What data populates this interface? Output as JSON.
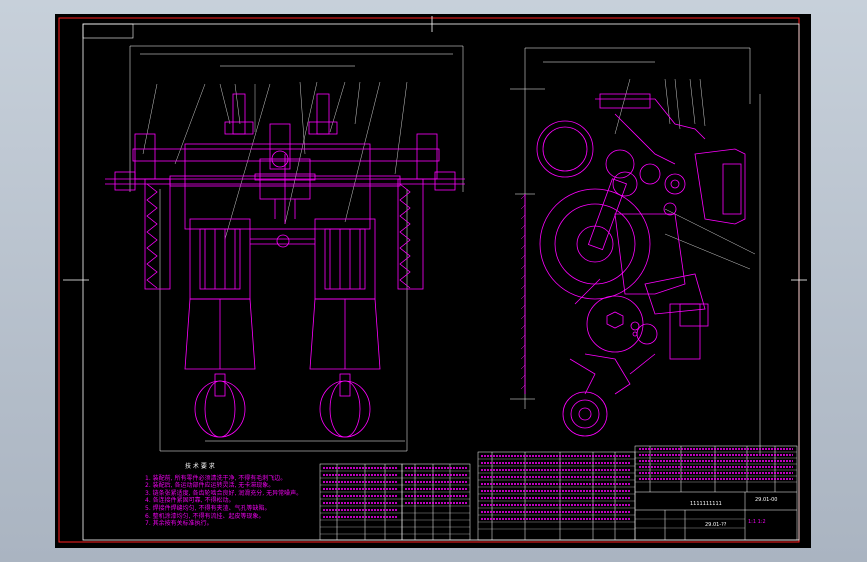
{
  "drawing": {
    "title_block_code": "29.01-00",
    "title_block_code_alt": "29.01-??",
    "title_block_text": "1111111111",
    "title_block_fragment": "1:1 1:2",
    "notes_heading": "技 术 要 求",
    "notes": [
      "1. 装配前, 所有零件必须清洗干净, 不得有毛刺飞边。",
      "2. 装配后, 各运动部件应运转灵活, 无卡滞现象。",
      "3. 链条张紧适度, 各齿轮啮合良好, 润滑充分, 无异常噪声。",
      "4. 各连接件紧固可靠, 不得松动。",
      "5. 焊接件焊缝均匀, 不得有夹渣、气孔等缺陷。",
      "6. 整机涂漆均匀, 不得有流挂、起皮等现象。",
      "7. 其余按有关标准执行。"
    ]
  },
  "colors": {
    "drawing_bg": "#000000",
    "frame": "#ff0000",
    "geometry": "#ff00ff",
    "text": "#ffffff",
    "dimension": "#ffffff",
    "window_bg": "#b9c3cf"
  }
}
